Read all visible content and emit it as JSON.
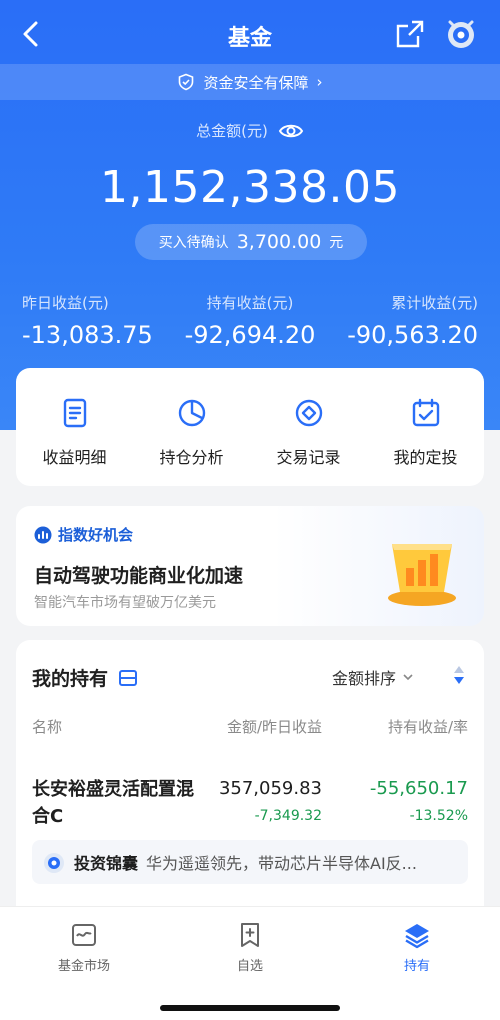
{
  "nav": {
    "title": "基金",
    "back_icon": "back-arrow-icon",
    "share_icon": "share-icon",
    "assistant_icon": "robot-assistant-icon"
  },
  "safety_banner": {
    "text": "资金安全有保障",
    "chevron": "›"
  },
  "summary": {
    "total_label": "总金额(元)",
    "total_value": "1,152,338.05",
    "pending_label": "买入待确认",
    "pending_amount": "3,700.00",
    "pending_unit": "元"
  },
  "stats": [
    {
      "label": "昨日收益(元)",
      "value": "-13,083.75"
    },
    {
      "label": "持有收益(元)",
      "value": "-92,694.20"
    },
    {
      "label": "累计收益(元)",
      "value": "-90,563.20"
    }
  ],
  "actions": [
    {
      "label": "收益明细",
      "icon": "document-icon"
    },
    {
      "label": "持仓分析",
      "icon": "pie-chart-icon"
    },
    {
      "label": "交易记录",
      "icon": "record-icon"
    },
    {
      "label": "我的定投",
      "icon": "calendar-icon"
    }
  ],
  "promo": {
    "tag": "指数好机会",
    "headline": "自动驾驶功能商业化加速",
    "subtitle": "智能汽车市场有望破万亿美元"
  },
  "holdings": {
    "title": "我的持有",
    "sort_label": "金额排序",
    "columns": [
      "名称",
      "金额/昨日收益",
      "持有收益/率"
    ],
    "rows": [
      {
        "name": "长安裕盛灵活配置混合C",
        "amount": "357,059.83",
        "yesterday": "-7,349.32",
        "holding_gain": "-55,650.17",
        "holding_rate": "-13.52%"
      }
    ],
    "insight": {
      "label": "投资锦囊",
      "text": "华为遥遥领先，带动芯片半导体AI反..."
    }
  },
  "tabbar": [
    {
      "label": "基金市场",
      "icon": "market-icon",
      "active": false
    },
    {
      "label": "自选",
      "icon": "bookmark-add-icon",
      "active": false
    },
    {
      "label": "持有",
      "icon": "layers-icon",
      "active": true
    }
  ],
  "colors": {
    "primary": "#2a6ef7",
    "gain_negative": "#1a9a4f"
  }
}
